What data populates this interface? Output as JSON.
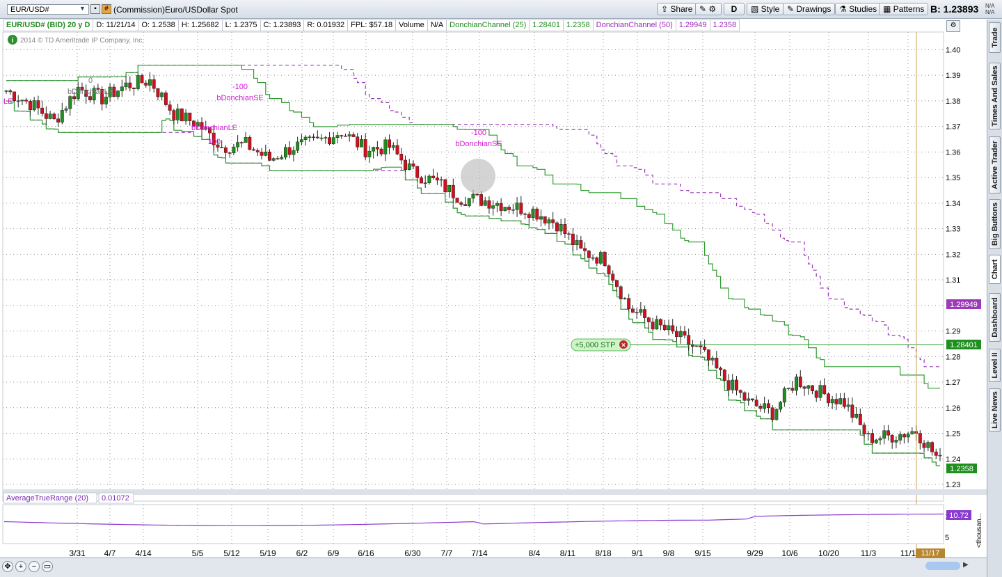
{
  "toolbar": {
    "symbol": "EUR/USD#",
    "description": "(Commission)Euro/USDollar Spot",
    "buttons": {
      "share": "Share",
      "period": "D",
      "style": "Style",
      "drawings": "Drawings",
      "studies": "Studies",
      "patterns": "Patterns"
    },
    "bid": "B: 1.23893",
    "na_top": "N/A",
    "na_bottom": "N/A"
  },
  "infobar": {
    "title": "EUR/USD# (BID) 20 y D",
    "date": "D: 11/21/14",
    "open": "O: 1.2538",
    "high": "H: 1.25682",
    "low": "L: 1.2375",
    "close": "C: 1.23893",
    "range": "R: 0.01932",
    "fpl": "FPL: $57.18",
    "volume": "Volume",
    "volume_val": "N/A",
    "dc25_name": "DonchianChannel (25)",
    "dc25_upper": "1.28401",
    "dc25_lower": "1.2358",
    "dc50_name": "DonchianChannel (50)",
    "dc50_upper": "1.29949",
    "dc50_lower": "1.2358"
  },
  "copyright": "2014 © TD Ameritrade IP Company, Inc.",
  "order": {
    "label": "+5,000 STP",
    "price": 1.284
  },
  "price_tags": {
    "dc50_upper": "1.29949",
    "dc25_upper": "1.28401",
    "lower": "1.2358"
  },
  "atr": {
    "name": "AverageTrueRange (20)",
    "value": "0.01072",
    "tag": "10.72",
    "axis_label": "<thousan...",
    "ticks": [
      "10",
      "5"
    ]
  },
  "sidebar": {
    "tabs": [
      "Trade",
      "Times And Sales",
      "Active Trader",
      "Big Buttons",
      "Chart",
      "Dashboard",
      "Level II",
      "Live News"
    ]
  },
  "bottom": {
    "date_tag": "11/17"
  },
  "colors": {
    "bull": "#1f8f1f",
    "bear": "#d0101e",
    "dc25": "#2f9a2f",
    "dc50": "#9c3ab8",
    "atr": "#8a3ad0",
    "grid": "#8c8c8c"
  },
  "chart_data": {
    "type": "candlestick",
    "ylim": [
      1.23,
      1.405
    ],
    "yticks": [
      1.23,
      1.24,
      1.25,
      1.26,
      1.27,
      1.28,
      1.29,
      1.3,
      1.31,
      1.32,
      1.33,
      1.34,
      1.35,
      1.36,
      1.37,
      1.38,
      1.39,
      1.4
    ],
    "xticks": [
      "3/31",
      "4/7",
      "4/14",
      "5/5",
      "5/12",
      "5/19",
      "6/2",
      "6/9",
      "6/16",
      "6/30",
      "7/7",
      "7/14",
      "8/4",
      "8/11",
      "8/18",
      "9/1",
      "9/8",
      "9/15",
      "9/29",
      "10/6",
      "10/20",
      "11/3",
      "11/1"
    ],
    "closes_weekly": [
      1.384,
      1.379,
      1.372,
      1.385,
      1.381,
      1.386,
      1.388,
      1.375,
      1.371,
      1.362,
      1.363,
      1.357,
      1.362,
      1.364,
      1.368,
      1.361,
      1.362,
      1.352,
      1.348,
      1.342,
      1.341,
      1.339,
      1.337,
      1.332,
      1.321,
      1.318,
      1.299,
      1.293,
      1.288,
      1.282,
      1.271,
      1.262,
      1.258,
      1.271,
      1.266,
      1.262,
      1.248,
      1.249,
      1.251,
      1.239
    ],
    "dc25_upper": 1.28401,
    "dc25_lower": 1.2358,
    "dc50_upper": 1.29949,
    "dc50_lower": 1.2358,
    "signals": [
      {
        "label": "bDonchianLE",
        "qty": "100"
      },
      {
        "label": "bDonchianSE",
        "qty": "-100"
      },
      {
        "label": "bDonchianLX",
        "qty": "0"
      },
      {
        "label": "bDonchianSE",
        "qty": "-100"
      },
      {
        "label": "LE",
        "qty": ""
      }
    ]
  }
}
